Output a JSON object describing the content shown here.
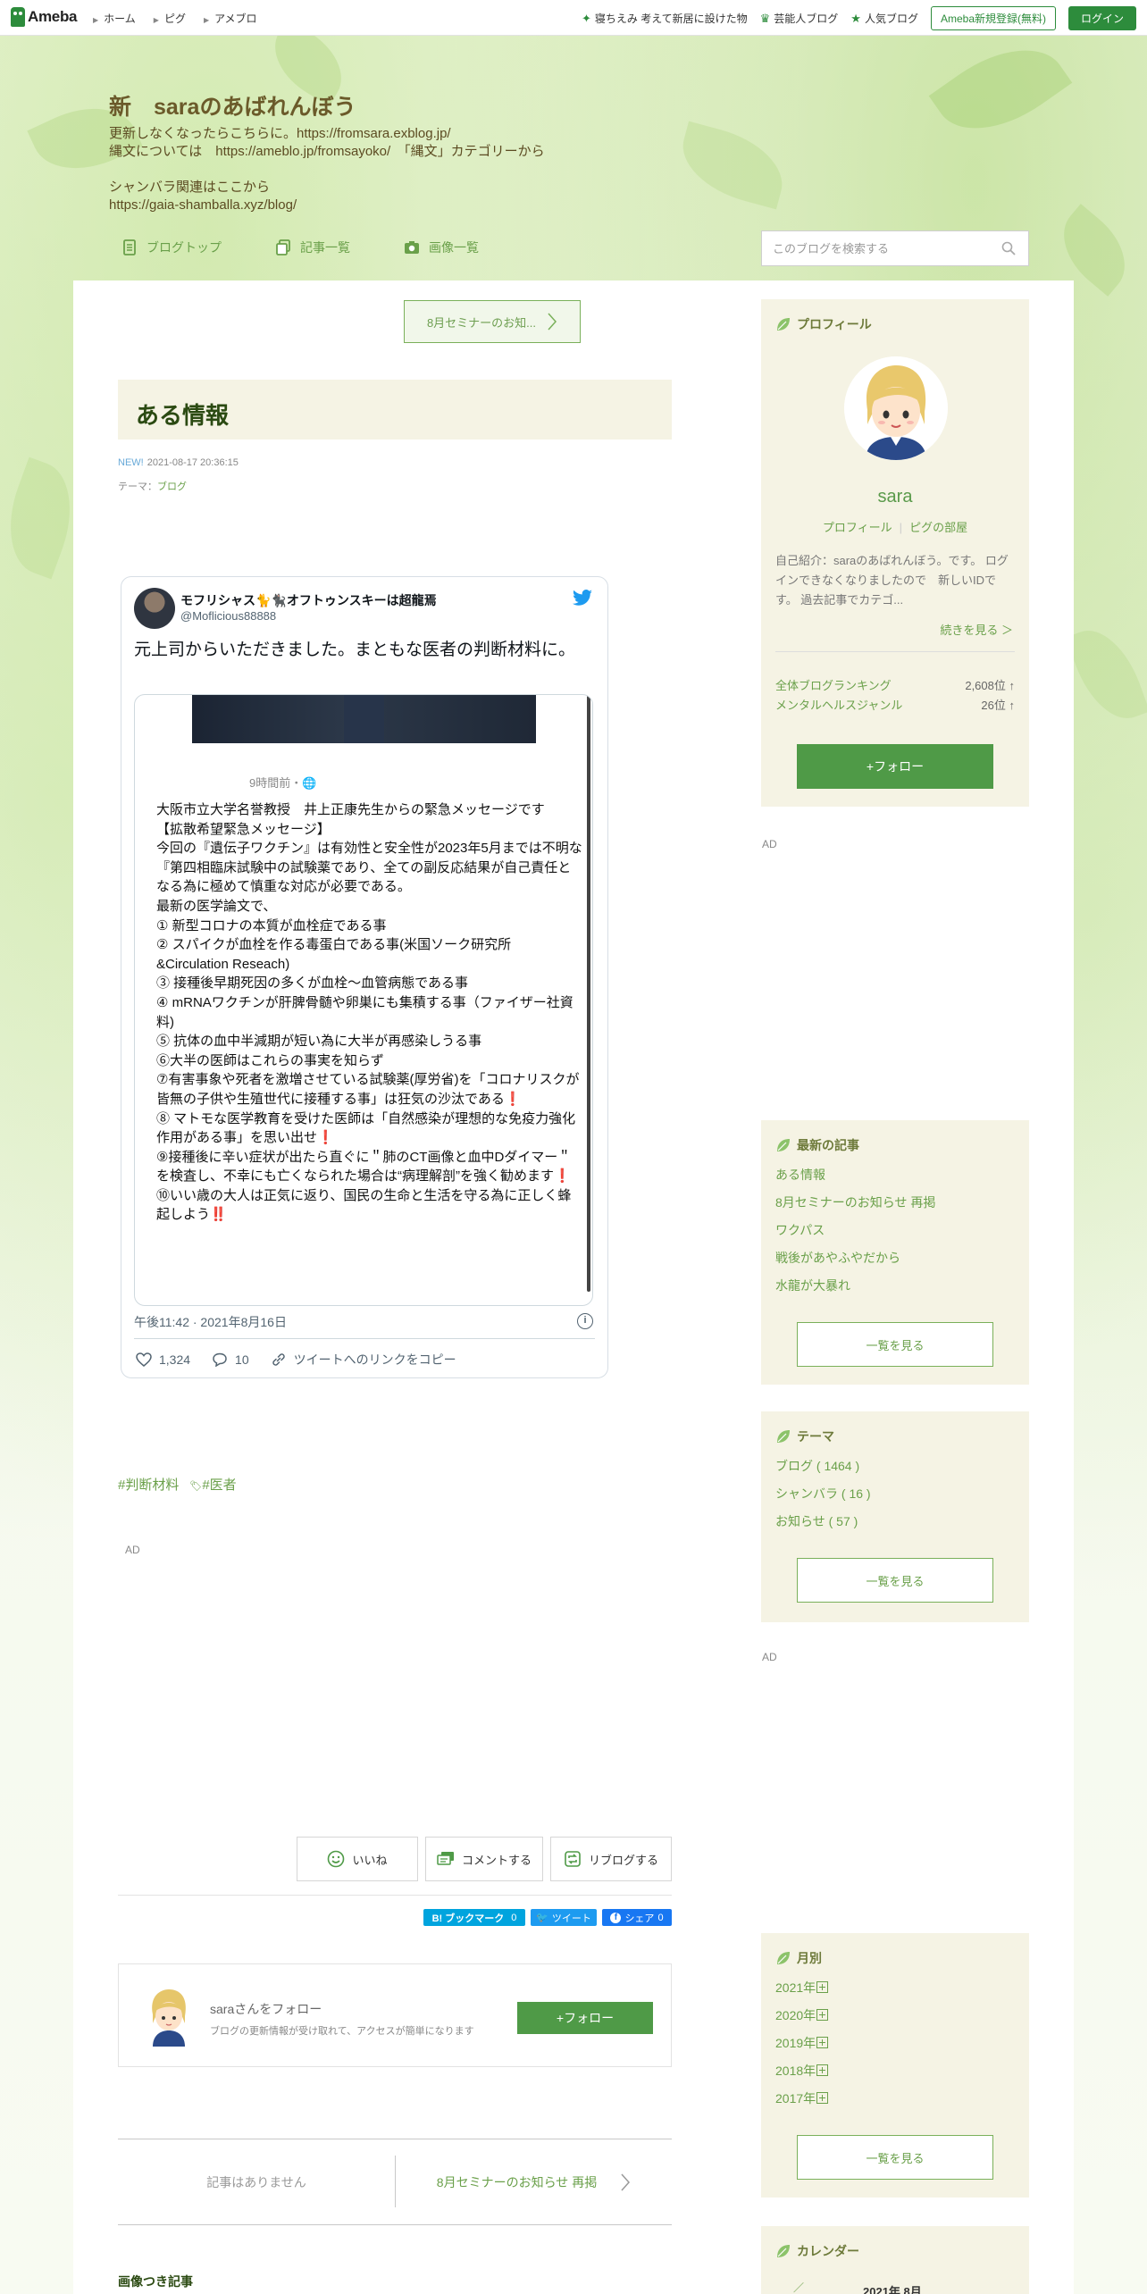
{
  "topbar": {
    "logo": "Ameba",
    "nav": [
      "ホーム",
      "ピグ",
      "アメブロ"
    ],
    "links": [
      {
        "icon": "sprout-icon",
        "label": "寝ちえみ 考えて新居に設けた物"
      },
      {
        "icon": "crown-icon",
        "label": "芸能人ブログ"
      },
      {
        "icon": "star-icon",
        "label": "人気ブログ"
      }
    ],
    "register": "Ameba新規登録(無料)",
    "login": "ログイン"
  },
  "blog": {
    "title": "新　saraのあばれんぼう",
    "description": "更新しなくなったらこちらに。https://fromsara.exblog.jp/\n縄文については　https://ameblo.jp/fromsayoko/　「縄文」カテゴリーから\n\nシャンバラ関連はここから\nhttps://gaia-shamballa.xyz/blog/",
    "nav": [
      "ブログトップ",
      "記事一覧",
      "画像一覧"
    ],
    "search_placeholder": "このブログを検索する"
  },
  "article": {
    "prev_link": "8月セミナーのお知...",
    "title": "ある情報",
    "new_badge": "NEW!",
    "datetime": "2021-08-17 20:36:15",
    "theme_label": "テーマ：",
    "theme": "ブログ",
    "hashtags": [
      "#判断材料",
      "#医者"
    ],
    "ad": "AD"
  },
  "tweet": {
    "name": "モフリシャス🐈🐈‍⬛オフトゥンスキーは超龍焉",
    "handle": "@Moflicious88888",
    "text": "元上司からいただきました。まともな医者の判断材料に。",
    "image_time": "9時間前・🌐",
    "image_body": "大阪市立大学名誉教授　井上正康先生からの緊急メッセージです\n【拡散希望緊急メッセージ】\n今回の『遺伝子ワクチン』は有効性と安全性が2023年5月までは不明な『第四相臨床試験中の試験薬であり、全ての副反応結果が自己責任となる為に極めて慎重な対応が必要である。\n最新の医学論文で、\n① 新型コロナの本質が血栓症である事\n② スパイクが血栓を作る毒蛋白である事(米国ソーク研究所&Circulation Reseach)\n③ 接種後早期死因の多くが血栓〜血管病態である事\n④ mRNAワクチンが肝脾骨髄や卵巣にも集積する事（ファイザー社資料)\n⑤ 抗体の血中半減期が短い為に大半が再感染しうる事\n⑥大半の医師はこれらの事実を知らず\n⑦有害事象や死者を激増させている試験薬(厚労省)を「コロナリスクが皆無の子供や生殖世代に接種する事」は狂気の沙汰である❗\n⑧ マトモな医学教育を受けた医師は「自然感染が理想的な免疫力強化作用がある事」を思い出せ❗\n⑨接種後に辛い症状が出たら直ぐに＂肺のCT画像と血中Dダイマー＂を検査し、不幸にも亡くなられた場合は“病理解剖”を強く勧めます❗\n⑩いい歳の大人は正気に返り、国民の生命と生活を守る為に正しく蜂起しよう‼️",
    "date": "午後11:42 · 2021年8月16日",
    "likes": "1,324",
    "replies": "10",
    "copy_link": "ツイートへのリンクをコピー"
  },
  "reactions": {
    "like": "いいね",
    "comment": "コメントする",
    "reblog": "リブログする"
  },
  "share": {
    "hatena": "B! ブックマーク",
    "hatena_count": "0",
    "tweet": "ツイート",
    "facebook": "シェア",
    "facebook_count": "0"
  },
  "follow_box": {
    "name": "saraさんをフォロー",
    "desc": "ブログの更新情報が受け取れて、アクセスが簡単になります",
    "button": "+フォロー"
  },
  "pager": {
    "prev": "記事はありません",
    "next": "8月セミナーのお知らせ 再掲"
  },
  "image_articles": "画像つき記事",
  "sidebar": {
    "profile": {
      "heading": "プロフィール",
      "name": "sara",
      "link1": "プロフィール",
      "link2": "ピグの部屋",
      "intro": "自己紹介：saraのあばれんぼう。です。 ログインできなくなりましたので　新しいIDです。 過去記事でカテゴ...",
      "more": "続きを見る ＞",
      "ranking_label": "全体ブログランキング",
      "ranking_value": "2,608位 ↑",
      "genre_label": "メンタルヘルスジャンル",
      "genre_value": "26位 ↑",
      "follow": "+フォロー"
    },
    "ad": "AD",
    "recent": {
      "heading": "最新の記事",
      "items": [
        "ある情報",
        "8月セミナーのお知らせ 再掲",
        "ワクパス",
        "戦後があやふやだから",
        "水龍が大暴れ"
      ],
      "more": "一覧を見る"
    },
    "themes": {
      "heading": "テーマ",
      "items": [
        "ブログ ( 1464 )",
        "シャンバラ ( 16 )",
        "お知らせ ( 57 )"
      ],
      "more": "一覧を見る"
    },
    "monthly": {
      "heading": "月別",
      "items": [
        "2021年",
        "2020年",
        "2019年",
        "2018年",
        "2017年"
      ],
      "more": "一覧を見る"
    },
    "calendar": {
      "heading": "カレンダー",
      "month": "2021年 8月"
    }
  },
  "colors": {
    "brand": "#2d8c3c",
    "accent_green": "#6aa04a",
    "follow_green": "#4f9a47",
    "sidebar_bg": "#f5f3e4"
  }
}
